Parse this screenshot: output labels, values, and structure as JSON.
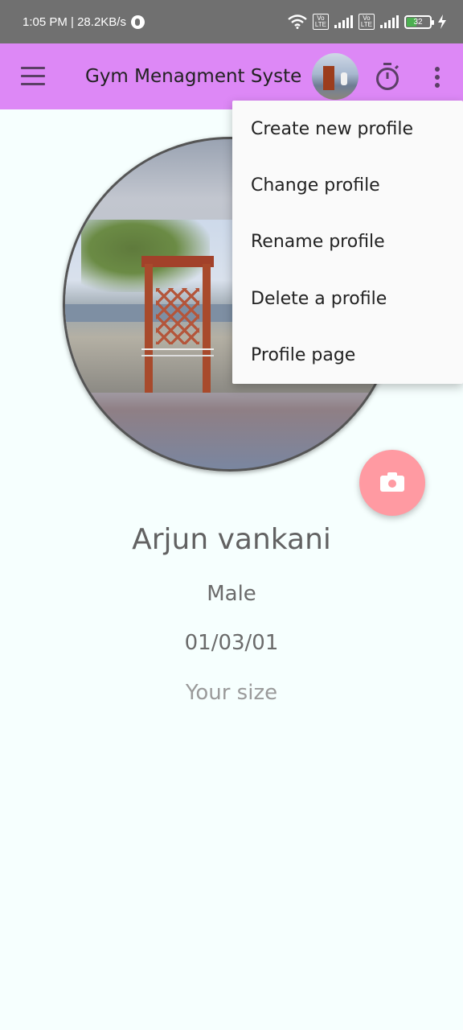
{
  "status_bar": {
    "time_and_speed": "1:05 PM | 28.2KB/s",
    "volte_1": "Vo\nLTE",
    "volte_2": "Vo\nLTE",
    "battery_level": "32",
    "icons": [
      "app-notification-icon",
      "wifi-icon",
      "volte-icon",
      "signal-icon",
      "volte-icon",
      "signal-icon",
      "battery-icon",
      "charging-icon"
    ]
  },
  "app_bar": {
    "title": "Gym Menagment System",
    "colors": {
      "background": "#dd88f6"
    },
    "icons": [
      "menu-icon",
      "avatar",
      "timer-icon",
      "more-vert-icon"
    ]
  },
  "profile": {
    "name": "Arjun vankani",
    "gender": "Male",
    "dob": "01/03/01",
    "size_placeholder": "Your size"
  },
  "fab": {
    "icon": "camera-icon",
    "color": "#ff9aa2"
  },
  "menu": {
    "items": [
      {
        "label": "Create new profile"
      },
      {
        "label": "Change profile"
      },
      {
        "label": "Rename profile"
      },
      {
        "label": "Delete a profile"
      },
      {
        "label": "Profile page"
      }
    ]
  }
}
